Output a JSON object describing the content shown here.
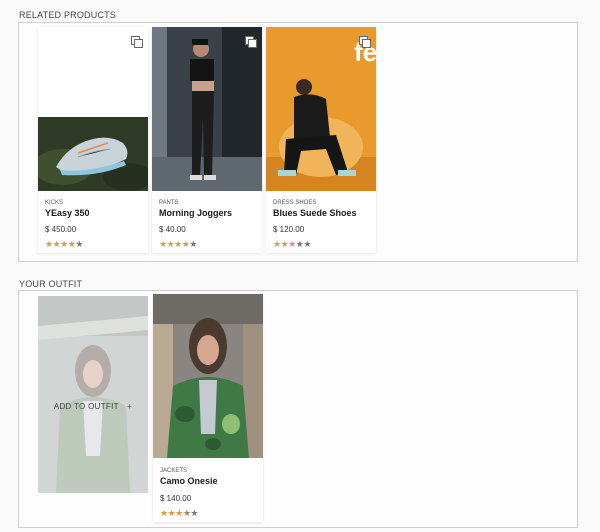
{
  "related": {
    "title": "RELATED PRODUCTS",
    "products": [
      {
        "category": "KICKS",
        "name": "YEasy 350",
        "price": "$ 450.00",
        "rating": 4
      },
      {
        "category": "PANTS",
        "name": "Morning Joggers",
        "price": "$ 40.00",
        "rating": 4
      },
      {
        "category": "DRESS SHOES",
        "name": "Blues Suede Shoes",
        "price": "$ 120.00",
        "rating": 3
      }
    ],
    "banner_text": "fe"
  },
  "outfit": {
    "title": "YOUR OUTFIT",
    "add_label": "ADD TO OUTFIT",
    "add_plus": "+",
    "products": [
      {
        "category": "JACKETS",
        "name": "Camo Onesie",
        "price": "$ 140.00",
        "rating": 3.5
      }
    ]
  },
  "colors": {
    "star_on": "#e8963a",
    "star_off": "#777777",
    "border": "#cfcfcf"
  },
  "icons": {
    "compare": "compare-icon",
    "star": "star-icon",
    "plus": "plus-icon"
  }
}
